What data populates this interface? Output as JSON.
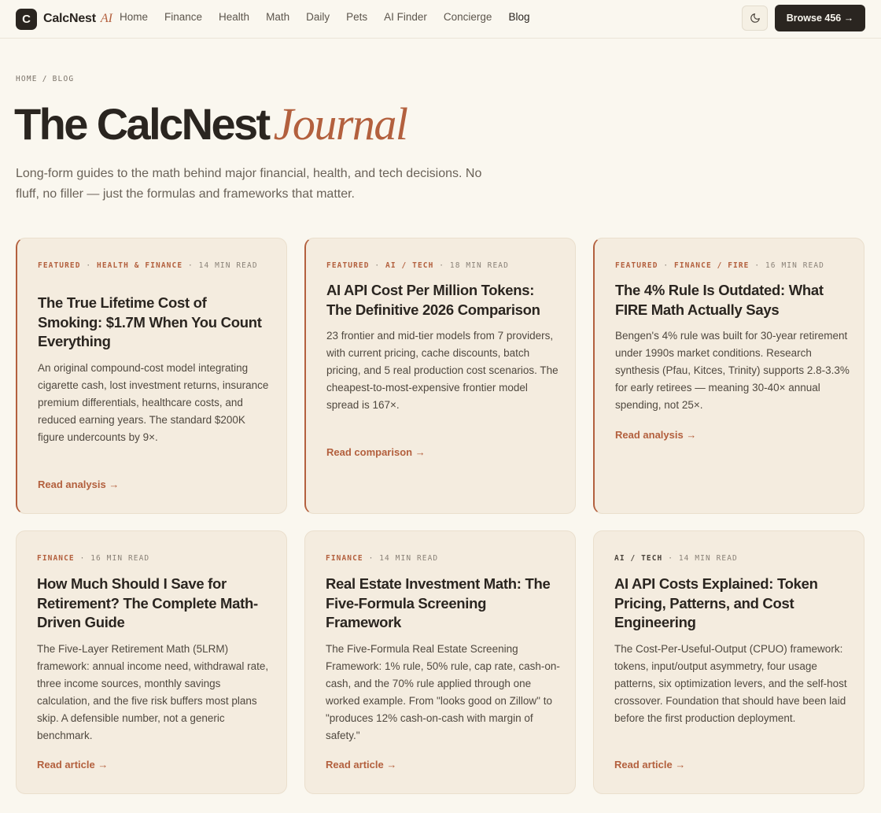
{
  "header": {
    "logo_mark": "C",
    "brand": "CalcNest",
    "brand_ai": "AI",
    "nav": [
      "Home",
      "Finance",
      "Health",
      "Math",
      "Daily",
      "Pets",
      "AI Finder",
      "Concierge",
      "Blog"
    ],
    "active_nav": "Blog",
    "browse_label": "Browse 456 →"
  },
  "breadcrumb": {
    "home": "HOME",
    "sep": "/",
    "current": "BLOG"
  },
  "hero": {
    "title": "The CalcNest",
    "title_script": "Journal",
    "lede": "Long-form guides to the math behind major financial, health, and tech decisions. No fluff, no filler — just the formulas and frameworks that matter."
  },
  "cards": [
    {
      "featured": "FEATURED",
      "category": "HEALTH & FINANCE",
      "read_time": "14 MIN READ",
      "title": "The True Lifetime Cost of Smoking: $1.7M When You Count Everything",
      "summary": "An original compound-cost model integrating cigarette cash, lost investment returns, insurance premium differentials, healthcare costs, and reduced earning years. The standard $200K figure undercounts by 9×.",
      "link": "Read analysis →"
    },
    {
      "featured": "FEATURED",
      "category": "AI / TECH",
      "read_time": "18 MIN READ",
      "title": "AI API Cost Per Million Tokens: The Definitive 2026 Comparison",
      "summary": "23 frontier and mid-tier models from 7 providers, with current pricing, cache discounts, batch pricing, and 5 real production cost scenarios. The cheapest-to-most-expensive frontier model spread is 167×.",
      "link": "Read comparison →"
    },
    {
      "featured": "FEATURED",
      "category": "FINANCE / FIRE",
      "read_time": "16 MIN READ",
      "title": "The 4% Rule Is Outdated: What FIRE Math Actually Says",
      "summary": "Bengen's 4% rule was built for 30-year retirement under 1990s market conditions. Research synthesis (Pfau, Kitces, Trinity) supports 2.8-3.3% for early retirees — meaning 30-40× annual spending, not 25×.",
      "link": "Read analysis →"
    },
    {
      "category": "FINANCE",
      "read_time": "16 MIN READ",
      "title": "How Much Should I Save for Retirement? The Complete Math-Driven Guide",
      "summary": "The Five-Layer Retirement Math (5LRM) framework: annual income need, withdrawal rate, three income sources, monthly savings calculation, and the five risk buffers most plans skip. A defensible number, not a generic benchmark.",
      "link": "Read article →"
    },
    {
      "category": "FINANCE",
      "read_time": "14 MIN READ",
      "title": "Real Estate Investment Math: The Five-Formula Screening Framework",
      "summary": "The Five-Formula Real Estate Screening Framework: 1% rule, 50% rule, cap rate, cash-on-cash, and the 70% rule applied through one worked example. From \"looks good on Zillow\" to \"produces 12% cash-on-cash with margin of safety.\"",
      "link": "Read article →"
    },
    {
      "category": "AI / TECH",
      "read_time": "14 MIN READ",
      "title": "AI API Costs Explained: Token Pricing, Patterns, and Cost Engineering",
      "summary": "The Cost-Per-Useful-Output (CPUO) framework: tokens, input/output asymmetry, four usage patterns, six optimization levers, and the self-host crossover. Foundation that should have been laid before the first production deployment.",
      "link": "Read article →"
    }
  ],
  "colors": {
    "accent": "#b3603e",
    "ink": "#2a2520",
    "background": "#faf7ef",
    "card": "#f4ecdf"
  },
  "icons": {
    "theme_toggle": "moon-icon"
  }
}
